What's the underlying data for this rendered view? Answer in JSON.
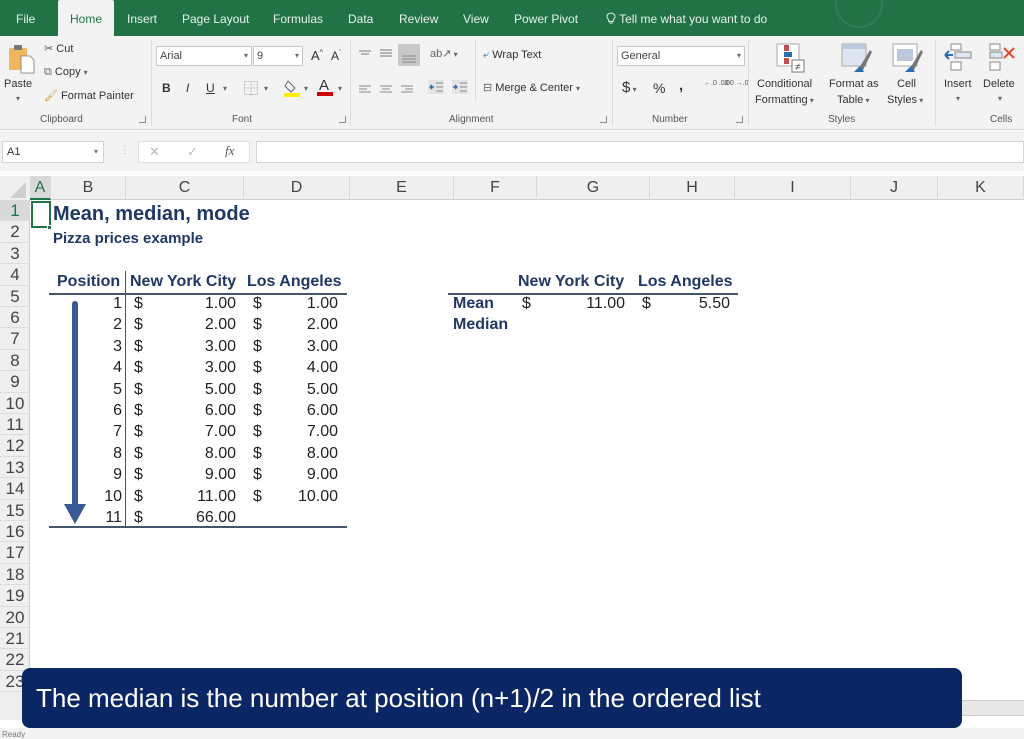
{
  "ribbon_tabs": [
    {
      "label": "File",
      "active": false
    },
    {
      "label": "Home",
      "active": true
    },
    {
      "label": "Insert",
      "active": false
    },
    {
      "label": "Page Layout",
      "active": false
    },
    {
      "label": "Formulas",
      "active": false
    },
    {
      "label": "Data",
      "active": false
    },
    {
      "label": "Review",
      "active": false
    },
    {
      "label": "View",
      "active": false
    },
    {
      "label": "Power Pivot",
      "active": false
    }
  ],
  "tell_me": "Tell me what you want to do",
  "clipboard": {
    "paste": "Paste",
    "cut": "Cut",
    "copy": "Copy",
    "format_painter": "Format Painter",
    "group_label": "Clipboard"
  },
  "font": {
    "font_name": "Arial",
    "font_size": "9",
    "bold": "B",
    "italic": "I",
    "underline": "U",
    "grow": "A",
    "shrink": "A",
    "font_color": "A",
    "group_label": "Font"
  },
  "alignment": {
    "wrap_text": "Wrap Text",
    "merge_center": "Merge & Center",
    "group_label": "Alignment"
  },
  "number": {
    "format": "General",
    "currency": "$",
    "percent": "%",
    "comma": ",",
    "inc_decimal": "←.0 .00",
    "dec_decimal": ".00 →.0",
    "group_label": "Number"
  },
  "styles": {
    "conditional_formatting_1": "Conditional",
    "conditional_formatting_2": "Formatting",
    "format_as_table_1": "Format as",
    "format_as_table_2": "Table",
    "cell_styles_1": "Cell",
    "cell_styles_2": "Styles",
    "group_label": "Styles"
  },
  "cells": {
    "insert": "Insert",
    "delete": "Delete",
    "group_label": "Cells"
  },
  "formula_bar": {
    "name_box": "A1",
    "cancel": "✕",
    "enter": "✓",
    "fx": "fx",
    "formula": ""
  },
  "columns": [
    "A",
    "B",
    "C",
    "D",
    "E",
    "F",
    "G",
    "H",
    "I",
    "J",
    "K"
  ],
  "rows": [
    "1",
    "2",
    "3",
    "4",
    "5",
    "6",
    "7",
    "8",
    "9",
    "10",
    "11",
    "12",
    "13",
    "14",
    "15",
    "16",
    "17",
    "18",
    "19",
    "20",
    "21",
    "22",
    "23"
  ],
  "sheet": {
    "title": "Mean, median, mode",
    "subtitle": "Pizza prices example",
    "table1": {
      "headers": [
        "Position",
        "New York City",
        "Los Angeles"
      ],
      "rows": [
        {
          "position": "1",
          "nyc_sym": "$",
          "nyc": "1.00",
          "la_sym": "$",
          "la": "1.00"
        },
        {
          "position": "2",
          "nyc_sym": "$",
          "nyc": "2.00",
          "la_sym": "$",
          "la": "2.00"
        },
        {
          "position": "3",
          "nyc_sym": "$",
          "nyc": "3.00",
          "la_sym": "$",
          "la": "3.00"
        },
        {
          "position": "4",
          "nyc_sym": "$",
          "nyc": "3.00",
          "la_sym": "$",
          "la": "4.00"
        },
        {
          "position": "5",
          "nyc_sym": "$",
          "nyc": "5.00",
          "la_sym": "$",
          "la": "5.00"
        },
        {
          "position": "6",
          "nyc_sym": "$",
          "nyc": "6.00",
          "la_sym": "$",
          "la": "6.00"
        },
        {
          "position": "7",
          "nyc_sym": "$",
          "nyc": "7.00",
          "la_sym": "$",
          "la": "7.00"
        },
        {
          "position": "8",
          "nyc_sym": "$",
          "nyc": "8.00",
          "la_sym": "$",
          "la": "8.00"
        },
        {
          "position": "9",
          "nyc_sym": "$",
          "nyc": "9.00",
          "la_sym": "$",
          "la": "9.00"
        },
        {
          "position": "10",
          "nyc_sym": "$",
          "nyc": "11.00",
          "la_sym": "$",
          "la": "10.00"
        },
        {
          "position": "11",
          "nyc_sym": "$",
          "nyc": "66.00",
          "la_sym": "",
          "la": ""
        }
      ]
    },
    "table2": {
      "headers": [
        "New York City",
        "Los Angeles"
      ],
      "rows": [
        {
          "label": "Mean",
          "nyc_sym": "$",
          "nyc": "11.00",
          "la_sym": "$",
          "la": "5.50"
        },
        {
          "label": "Median",
          "nyc_sym": "",
          "nyc": "",
          "la_sym": "",
          "la": ""
        }
      ]
    }
  },
  "caption": "The median is the number at position (n+1)/2 in the ordered list",
  "status": "Ready",
  "colors": {
    "excel_green": "#217346",
    "heading_navy": "#1f3864",
    "caption_bg": "#0b2665",
    "arrow_blue": "#3a5a95"
  }
}
